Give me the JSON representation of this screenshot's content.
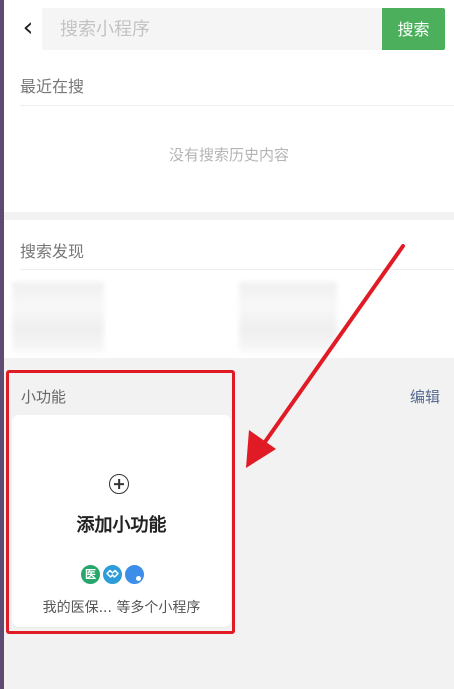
{
  "header": {
    "back_icon": "chevron-left-icon",
    "search_placeholder": "搜索小程序",
    "search_button": "搜索"
  },
  "recent": {
    "title": "最近在搜",
    "empty_text": "没有搜索历史内容"
  },
  "discover": {
    "title": "搜索发现"
  },
  "small_functions": {
    "title": "小功能",
    "edit_label": "编辑",
    "add_label": "添加小功能",
    "mini_program_icons": [
      {
        "name": "medical-icon",
        "label": "医",
        "color": "#28a76d"
      },
      {
        "name": "handshake-icon",
        "label": "",
        "color": "#2d9cd8"
      },
      {
        "name": "chat-icon",
        "label": "",
        "color": "#3d8ee8"
      }
    ],
    "programs_caption": "我的医保... 等多个小程序"
  },
  "colors": {
    "accent_green": "#4caf5c",
    "highlight_red": "#e11b26",
    "edit_blue": "#556b8f"
  }
}
